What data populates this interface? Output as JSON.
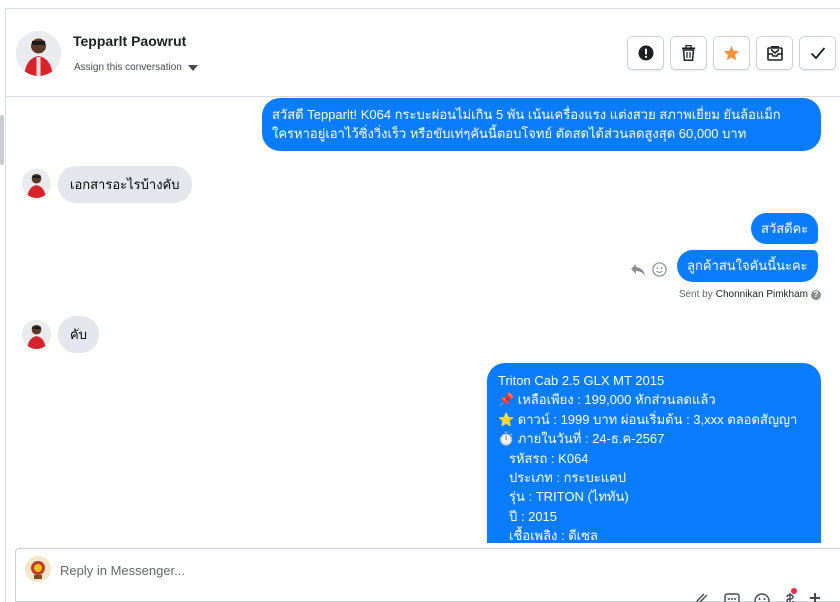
{
  "header": {
    "contact_name": "Tepparlt Paowrut",
    "assign_label": "Assign this conversation",
    "actions": [
      {
        "name": "spam-button",
        "icon": "exclamation-icon"
      },
      {
        "name": "delete-button",
        "icon": "trash-icon"
      },
      {
        "name": "star-button",
        "icon": "star-icon",
        "color": "#f7923b"
      },
      {
        "name": "archive-button",
        "icon": "mail-archive-icon"
      },
      {
        "name": "done-button",
        "icon": "checkmark-icon"
      }
    ]
  },
  "messages": [
    {
      "from": "page",
      "line1": "สวัสดี Tepparlt! K064 กระบะผ่อนไม่เกิน 5 พัน เน้นเครื่องแรง แต่งสวย สภาพเยี่ยม ยันล้อแม็ก",
      "line2": "ใครหาอยู่เอาไว้ซิ่งวิ่งเร็ว หรือขับเท่ๆคันนี้ตอบโจทย์ ตัดสดได้ส่วนลดสูงสุด 60,000 บาท"
    },
    {
      "from": "contact",
      "text": "เอกสารอะไรบ้างคับ"
    },
    {
      "from": "page",
      "text": "สวัสดีคะ"
    },
    {
      "from": "page",
      "text": "ลูกค้าสนใจคันนี้นะคะ"
    },
    {
      "from": "contact",
      "text": "คับ"
    },
    {
      "from": "page",
      "lines": [
        "Triton Cab 2.5 GLX MT 2015",
        "📌 เหลือเพียง : 199,000 หักส่วนลดแล้ว",
        "⭐ ดาวน์ : 1999 บาท ผ่อนเริ่มต้น : 3,xxx ตลอดสัญญา",
        "⏱️ ภายในวันที่ : 24-ธ.ค-2567",
        "รหัสรถ : K064",
        "ประเภท : กระบะแคป",
        "รุ่น : TRITON (ไททัน)",
        "ปี : 2015",
        "เชื้อเพลิง : ดีเซล"
      ]
    }
  ],
  "sent_by": {
    "prefix": "Sent by",
    "name": "Chonnikan Pimkham"
  },
  "reply": {
    "placeholder": "Reply in Messenger..."
  },
  "colors": {
    "outgoing_bubble": "#0a7cff",
    "incoming_bubble": "#e4e6eb"
  }
}
